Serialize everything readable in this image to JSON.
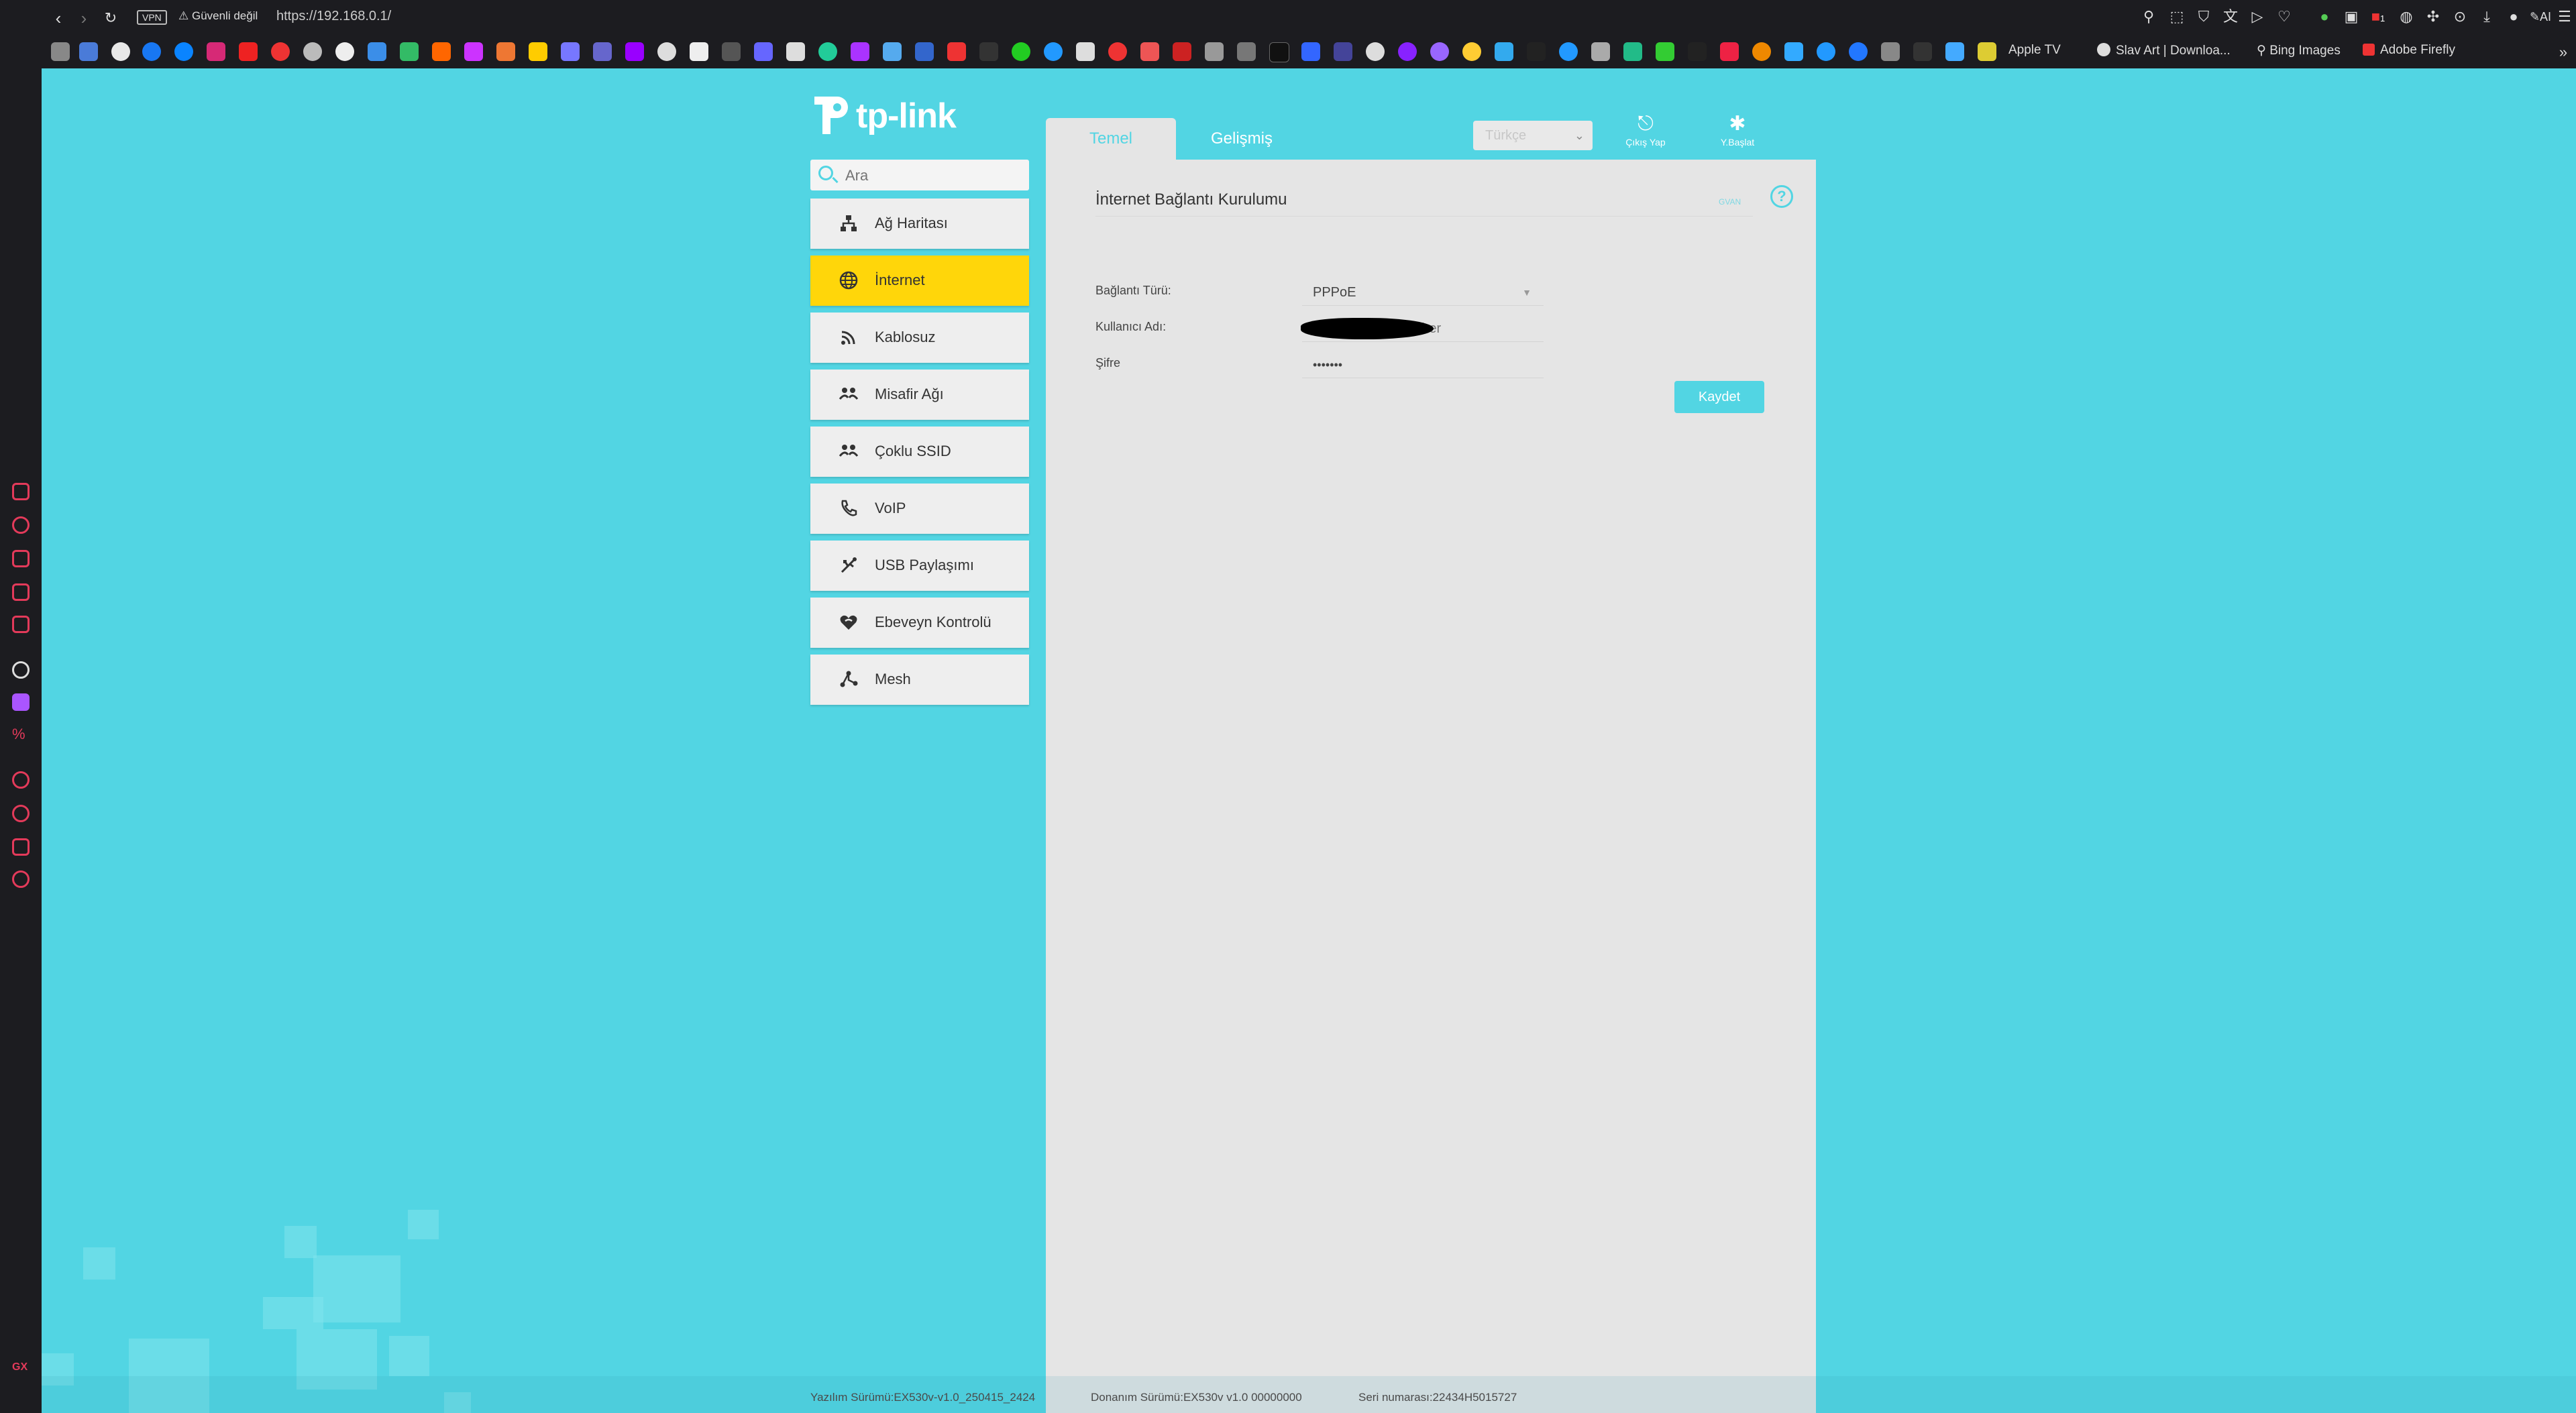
{
  "browser": {
    "vpn_label": "VPN",
    "security_label": "Güvenli değil",
    "url": "https://192.168.0.1/",
    "tab_badge": "1",
    "ai_label": "AI",
    "bookmarks": [
      {
        "label": "Apple TV"
      },
      {
        "label": "Slav Art | Downloa..."
      },
      {
        "label": "Bing Images"
      },
      {
        "label": "Adobe Firefly"
      }
    ],
    "sidebar_footer": "GX"
  },
  "router": {
    "brand": "tp-link",
    "search_placeholder": "Ara",
    "tabs": [
      {
        "label": "Temel",
        "active": true
      },
      {
        "label": "Gelişmiş",
        "active": false
      }
    ],
    "language": "Türkçe",
    "logout_label": "Çıkış Yap",
    "reboot_label": "Y.Başlat",
    "menu": [
      {
        "label": "Ağ Haritası",
        "icon": "network-map-icon"
      },
      {
        "label": "İnternet",
        "icon": "globe-icon",
        "active": true
      },
      {
        "label": "Kablosuz",
        "icon": "wireless-icon"
      },
      {
        "label": "Misafir Ağı",
        "icon": "guest-network-icon"
      },
      {
        "label": "Çoklu SSID",
        "icon": "multi-ssid-icon"
      },
      {
        "label": "VoIP",
        "icon": "phone-icon"
      },
      {
        "label": "USB Paylaşımı",
        "icon": "usb-icon"
      },
      {
        "label": "Ebeveyn Kontrolü",
        "icon": "parental-control-icon"
      },
      {
        "label": "Mesh",
        "icon": "mesh-icon"
      }
    ],
    "section": {
      "title": "İnternet Bağlantı Kurulumu",
      "advanced_label": "GVAN",
      "fields": [
        {
          "label": "Bağlantı Türü:",
          "value": "PPPoE"
        },
        {
          "label": "Kullanıcı Adı:",
          "value": "@fiber"
        },
        {
          "label": "Şifre",
          "value": "•••••••"
        }
      ],
      "save_label": "Kaydet"
    },
    "footer": {
      "software": "Yazılım Sürümü:EX530v-v1.0_250415_2424",
      "hardware": "Donanım Sürümü:EX530v v1.0 00000000",
      "serial": "Seri numarası:22434H5015727"
    }
  },
  "colors": {
    "accent": "#52d5e3",
    "active_menu": "#ffd60a",
    "panel": "#e5e5e5"
  }
}
